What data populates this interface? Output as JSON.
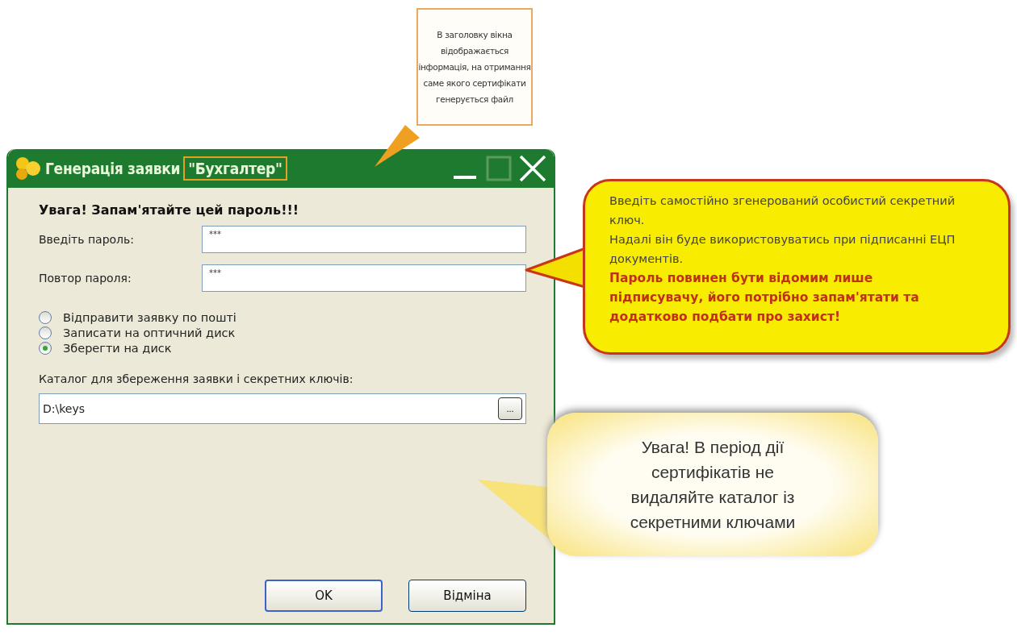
{
  "title_callout": {
    "lines": [
      "В заголовку вікна",
      "відображається",
      "інформація, на отримання",
      "саме якого сертифікати",
      "генерується файл"
    ]
  },
  "dialog": {
    "title": "Генерація заявки",
    "title_highlight": "\"Бухгалтер\"",
    "heading": "Увага! Запам'ятайте цей пароль!!!",
    "fields": [
      {
        "label": "Введіть пароль:",
        "value": "***"
      },
      {
        "label": "Повтор пароля:",
        "value": "***"
      }
    ],
    "radios": [
      {
        "label": "Відправити заявку  по пошті",
        "selected": false
      },
      {
        "label": "Записати на оптичний диск",
        "selected": false
      },
      {
        "label": "Зберегти на диск",
        "selected": true
      }
    ],
    "folder_label": "Каталог для збереження заявки і секретних ключів:",
    "folder_value": "D:\\keys",
    "browse_button": "...",
    "buttons": [
      {
        "label": "OK",
        "default": true
      },
      {
        "label": "Відміна",
        "default": false
      }
    ]
  },
  "password_callout": {
    "paragraphs": [
      {
        "kind": "normal",
        "text": "Введіть самостійно згенерований особистий секретний ключ."
      },
      {
        "kind": "normal",
        "text": "Надалі він буде використовуватись при підписанні ЕЦП документів."
      },
      {
        "kind": "warning",
        "text": "Пароль повинен бути відомим лише підписувачу, його потрібно запам'ятати та додатково подбати про захист!"
      }
    ]
  },
  "folder_callout": {
    "lines": [
      "Увага! В період дії",
      "сертифікатів не",
      "видаляйте каталог із",
      "секретними ключами"
    ]
  }
}
